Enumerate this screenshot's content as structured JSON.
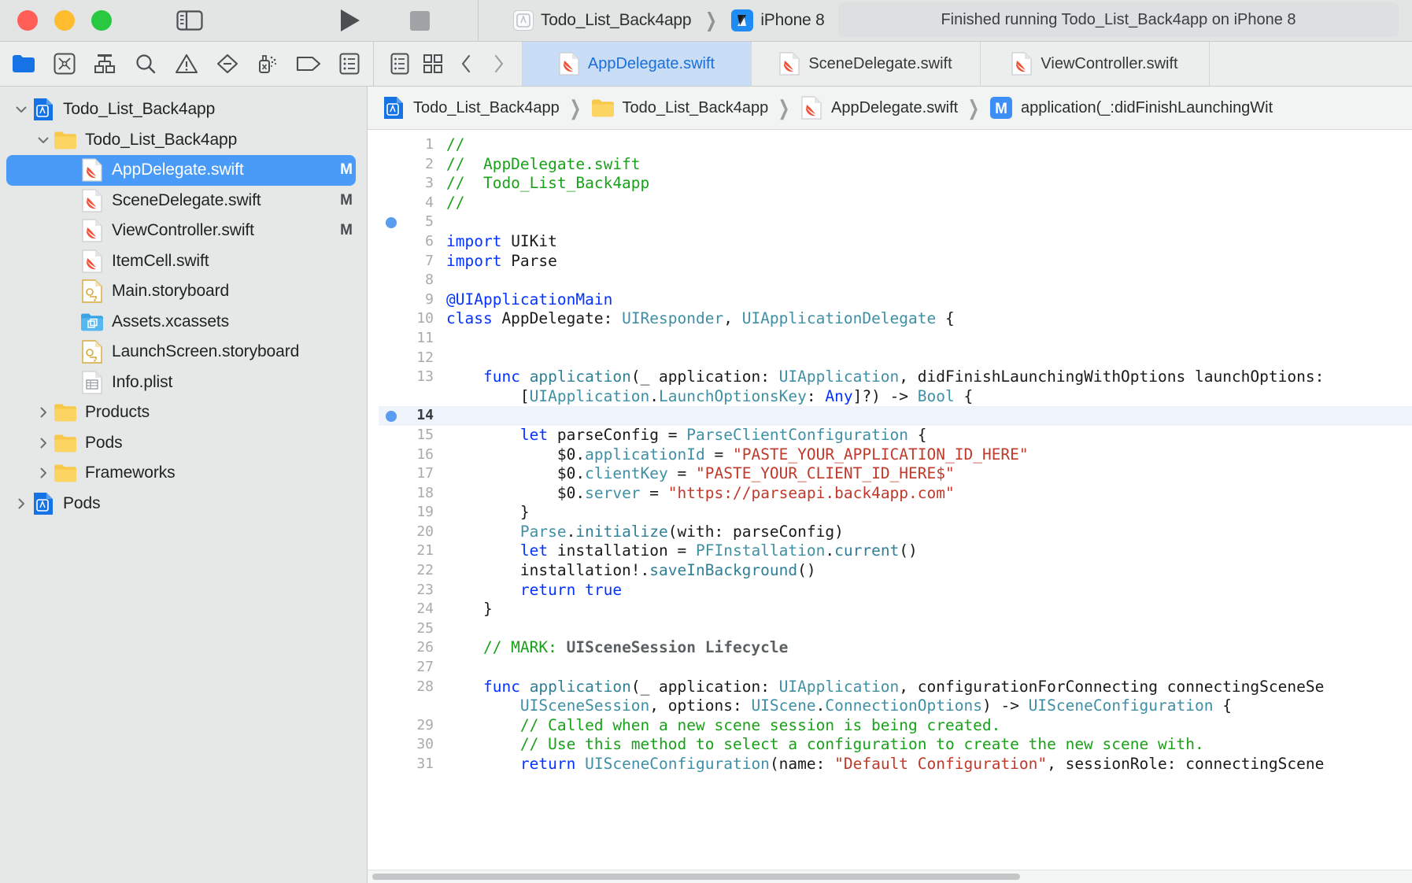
{
  "window": {
    "traffic_lights": [
      "close",
      "minimize",
      "maximize"
    ],
    "sidebar_toggle": "sidebar-toggle",
    "run_button": "run",
    "stop_button": "stop"
  },
  "scheme": {
    "project_name": "Todo_List_Back4app",
    "destination": "iPhone 8",
    "separator": "❯"
  },
  "status": {
    "message": "Finished running Todo_List_Back4app on iPhone 8"
  },
  "navigator_icons": [
    {
      "name": "folder-icon",
      "title": "Project navigator"
    },
    {
      "name": "source-control-icon",
      "title": "Source control navigator"
    },
    {
      "name": "symbol-hierarchy-icon",
      "title": "Symbol navigator"
    },
    {
      "name": "search-icon",
      "title": "Find navigator"
    },
    {
      "name": "warning-triangle-icon",
      "title": "Issue navigator"
    },
    {
      "name": "test-diamond-icon",
      "title": "Test navigator"
    },
    {
      "name": "debug-spray-icon",
      "title": "Debug navigator"
    },
    {
      "name": "breakpoint-tag-icon",
      "title": "Breakpoint navigator"
    },
    {
      "name": "report-list-icon",
      "title": "Report navigator"
    }
  ],
  "editor_toolbar": [
    {
      "name": "related-items-icon",
      "title": "Related Items"
    },
    {
      "name": "grid-layout-icon",
      "title": "Editor options"
    },
    {
      "name": "back-chevron-icon",
      "title": "Go back"
    },
    {
      "name": "forward-chevron-icon",
      "title": "Go forward"
    }
  ],
  "tabs": [
    {
      "label": "AppDelegate.swift",
      "icon": "swift-file-icon",
      "active": true
    },
    {
      "label": "SceneDelegate.swift",
      "icon": "swift-file-icon",
      "active": false
    },
    {
      "label": "ViewController.swift",
      "icon": "swift-file-icon",
      "active": false
    }
  ],
  "navigator": {
    "items": [
      {
        "label": "Todo_List_Back4app",
        "icon": "xcode-project-icon",
        "indent": 0,
        "disclosure": "open",
        "badge": "",
        "selected": false
      },
      {
        "label": "Todo_List_Back4app",
        "icon": "folder-yellow-icon",
        "indent": 1,
        "disclosure": "open",
        "badge": "",
        "selected": false
      },
      {
        "label": "AppDelegate.swift",
        "icon": "swift-file-icon",
        "indent": 2,
        "disclosure": "none",
        "badge": "M",
        "selected": true
      },
      {
        "label": "SceneDelegate.swift",
        "icon": "swift-file-icon",
        "indent": 2,
        "disclosure": "none",
        "badge": "M",
        "selected": false
      },
      {
        "label": "ViewController.swift",
        "icon": "swift-file-icon",
        "indent": 2,
        "disclosure": "none",
        "badge": "M",
        "selected": false
      },
      {
        "label": "ItemCell.swift",
        "icon": "swift-file-icon",
        "indent": 2,
        "disclosure": "none",
        "badge": "",
        "selected": false
      },
      {
        "label": "Main.storyboard",
        "icon": "storyboard-icon",
        "indent": 2,
        "disclosure": "none",
        "badge": "",
        "selected": false
      },
      {
        "label": "Assets.xcassets",
        "icon": "assets-icon",
        "indent": 2,
        "disclosure": "none",
        "badge": "",
        "selected": false
      },
      {
        "label": "LaunchScreen.storyboard",
        "icon": "storyboard-icon",
        "indent": 2,
        "disclosure": "none",
        "badge": "",
        "selected": false
      },
      {
        "label": "Info.plist",
        "icon": "plist-icon",
        "indent": 2,
        "disclosure": "none",
        "badge": "",
        "selected": false
      },
      {
        "label": "Products",
        "icon": "folder-yellow-icon",
        "indent": 1,
        "disclosure": "closed",
        "badge": "",
        "selected": false
      },
      {
        "label": "Pods",
        "icon": "folder-yellow-icon",
        "indent": 1,
        "disclosure": "closed",
        "badge": "",
        "selected": false
      },
      {
        "label": "Frameworks",
        "icon": "folder-yellow-icon",
        "indent": 1,
        "disclosure": "closed",
        "badge": "",
        "selected": false
      },
      {
        "label": "Pods",
        "icon": "xcode-project-icon",
        "indent": 0,
        "disclosure": "closed",
        "badge": "",
        "selected": false
      }
    ]
  },
  "jumpbar": {
    "crumbs": [
      {
        "label": "Todo_List_Back4app",
        "icon": "xcode-project-icon"
      },
      {
        "label": "Todo_List_Back4app",
        "icon": "folder-yellow-icon"
      },
      {
        "label": "AppDelegate.swift",
        "icon": "swift-file-icon"
      },
      {
        "label": "application(_:didFinishLaunchingWit",
        "icon": "method-m-icon"
      }
    ],
    "separator": "❯"
  },
  "code": {
    "language": "swift",
    "highlighted_line": 14,
    "breakpoint_dots": [
      5,
      14
    ],
    "lines": [
      {
        "n": 1,
        "tokens": [
          {
            "t": "//",
            "c": "cmt"
          }
        ]
      },
      {
        "n": 2,
        "tokens": [
          {
            "t": "//  AppDelegate.swift",
            "c": "cmt"
          }
        ]
      },
      {
        "n": 3,
        "tokens": [
          {
            "t": "//  Todo_List_Back4app",
            "c": "cmt"
          }
        ]
      },
      {
        "n": 4,
        "tokens": [
          {
            "t": "//",
            "c": "cmt"
          }
        ]
      },
      {
        "n": 5,
        "tokens": []
      },
      {
        "n": 6,
        "tokens": [
          {
            "t": "import",
            "c": "kw"
          },
          {
            "t": " UIKit",
            "c": "plain"
          }
        ]
      },
      {
        "n": 7,
        "tokens": [
          {
            "t": "import",
            "c": "kw"
          },
          {
            "t": " Parse",
            "c": "plain"
          }
        ]
      },
      {
        "n": 8,
        "tokens": []
      },
      {
        "n": 9,
        "tokens": [
          {
            "t": "@UIApplicationMain",
            "c": "attr"
          }
        ]
      },
      {
        "n": 10,
        "tokens": [
          {
            "t": "class",
            "c": "kw"
          },
          {
            "t": " AppDelegate: ",
            "c": "plain"
          },
          {
            "t": "UIResponder",
            "c": "type"
          },
          {
            "t": ", ",
            "c": "plain"
          },
          {
            "t": "UIApplicationDelegate",
            "c": "type"
          },
          {
            "t": " {",
            "c": "plain"
          }
        ]
      },
      {
        "n": 11,
        "tokens": []
      },
      {
        "n": 12,
        "tokens": []
      },
      {
        "n": 13,
        "tokens": [
          {
            "t": "    ",
            "c": "plain"
          },
          {
            "t": "func",
            "c": "kw"
          },
          {
            "t": " ",
            "c": "plain"
          },
          {
            "t": "application",
            "c": "fn"
          },
          {
            "t": "(_ application: ",
            "c": "plain"
          },
          {
            "t": "UIApplication",
            "c": "type"
          },
          {
            "t": ", didFinishLaunchingWithOptions launchOptions:",
            "c": "plain"
          }
        ]
      },
      {
        "n": "",
        "tokens": [
          {
            "t": "        [",
            "c": "plain"
          },
          {
            "t": "UIApplication",
            "c": "type"
          },
          {
            "t": ".",
            "c": "plain"
          },
          {
            "t": "LaunchOptionsKey",
            "c": "type"
          },
          {
            "t": ": ",
            "c": "plain"
          },
          {
            "t": "Any",
            "c": "kw"
          },
          {
            "t": "]?) -> ",
            "c": "plain"
          },
          {
            "t": "Bool",
            "c": "type"
          },
          {
            "t": " {",
            "c": "plain"
          }
        ]
      },
      {
        "n": 14,
        "tokens": []
      },
      {
        "n": 15,
        "tokens": [
          {
            "t": "        ",
            "c": "plain"
          },
          {
            "t": "let",
            "c": "kw"
          },
          {
            "t": " parseConfig = ",
            "c": "plain"
          },
          {
            "t": "ParseClientConfiguration",
            "c": "type"
          },
          {
            "t": " {",
            "c": "plain"
          }
        ]
      },
      {
        "n": 16,
        "tokens": [
          {
            "t": "            $0.",
            "c": "plain"
          },
          {
            "t": "applicationId",
            "c": "prop"
          },
          {
            "t": " = ",
            "c": "plain"
          },
          {
            "t": "\"PASTE_YOUR_APPLICATION_ID_HERE\"",
            "c": "str"
          }
        ]
      },
      {
        "n": 17,
        "tokens": [
          {
            "t": "            $0.",
            "c": "plain"
          },
          {
            "t": "clientKey",
            "c": "prop"
          },
          {
            "t": " = ",
            "c": "plain"
          },
          {
            "t": "\"PASTE_YOUR_CLIENT_ID_HERE$\"",
            "c": "str"
          }
        ]
      },
      {
        "n": 18,
        "tokens": [
          {
            "t": "            $0.",
            "c": "plain"
          },
          {
            "t": "server",
            "c": "prop"
          },
          {
            "t": " = ",
            "c": "plain"
          },
          {
            "t": "\"https://parseapi.back4app.com\"",
            "c": "str"
          }
        ]
      },
      {
        "n": 19,
        "tokens": [
          {
            "t": "        }",
            "c": "plain"
          }
        ]
      },
      {
        "n": 20,
        "tokens": [
          {
            "t": "        ",
            "c": "plain"
          },
          {
            "t": "Parse",
            "c": "type"
          },
          {
            "t": ".",
            "c": "plain"
          },
          {
            "t": "initialize",
            "c": "fn"
          },
          {
            "t": "(with: parseConfig)",
            "c": "plain"
          }
        ]
      },
      {
        "n": 21,
        "tokens": [
          {
            "t": "        ",
            "c": "plain"
          },
          {
            "t": "let",
            "c": "kw"
          },
          {
            "t": " installation = ",
            "c": "plain"
          },
          {
            "t": "PFInstallation",
            "c": "type"
          },
          {
            "t": ".",
            "c": "plain"
          },
          {
            "t": "current",
            "c": "fn"
          },
          {
            "t": "()",
            "c": "plain"
          }
        ]
      },
      {
        "n": 22,
        "tokens": [
          {
            "t": "        installation!.",
            "c": "plain"
          },
          {
            "t": "saveInBackground",
            "c": "fn"
          },
          {
            "t": "()",
            "c": "plain"
          }
        ]
      },
      {
        "n": 23,
        "tokens": [
          {
            "t": "        ",
            "c": "plain"
          },
          {
            "t": "return true",
            "c": "kw"
          }
        ]
      },
      {
        "n": 24,
        "tokens": [
          {
            "t": "    }",
            "c": "plain"
          }
        ]
      },
      {
        "n": 25,
        "tokens": []
      },
      {
        "n": 26,
        "tokens": [
          {
            "t": "    // MARK: ",
            "c": "cmt"
          },
          {
            "t": "UISceneSession Lifecycle",
            "c": "cmtb"
          }
        ]
      },
      {
        "n": 27,
        "tokens": []
      },
      {
        "n": 28,
        "tokens": [
          {
            "t": "    ",
            "c": "plain"
          },
          {
            "t": "func",
            "c": "kw"
          },
          {
            "t": " ",
            "c": "plain"
          },
          {
            "t": "application",
            "c": "fn"
          },
          {
            "t": "(_ application: ",
            "c": "plain"
          },
          {
            "t": "UIApplication",
            "c": "type"
          },
          {
            "t": ", configurationForConnecting connectingSceneSe",
            "c": "plain"
          }
        ]
      },
      {
        "n": "",
        "tokens": [
          {
            "t": "        ",
            "c": "plain"
          },
          {
            "t": "UISceneSession",
            "c": "type"
          },
          {
            "t": ", options: ",
            "c": "plain"
          },
          {
            "t": "UIScene",
            "c": "type"
          },
          {
            "t": ".",
            "c": "plain"
          },
          {
            "t": "ConnectionOptions",
            "c": "type"
          },
          {
            "t": ") -> ",
            "c": "plain"
          },
          {
            "t": "UISceneConfiguration",
            "c": "type"
          },
          {
            "t": " {",
            "c": "plain"
          }
        ]
      },
      {
        "n": 29,
        "tokens": [
          {
            "t": "        // Called when a new scene session is being created.",
            "c": "cmt"
          }
        ]
      },
      {
        "n": 30,
        "tokens": [
          {
            "t": "        // Use this method to select a configuration to create the new scene with.",
            "c": "cmt"
          }
        ]
      },
      {
        "n": 31,
        "tokens": [
          {
            "t": "        ",
            "c": "plain"
          },
          {
            "t": "return",
            "c": "kw"
          },
          {
            "t": " ",
            "c": "plain"
          },
          {
            "t": "UISceneConfiguration",
            "c": "type"
          },
          {
            "t": "(name: ",
            "c": "plain"
          },
          {
            "t": "\"Default Configuration\"",
            "c": "str"
          },
          {
            "t": ", sessionRole: connectingScene",
            "c": "plain"
          }
        ]
      }
    ]
  }
}
